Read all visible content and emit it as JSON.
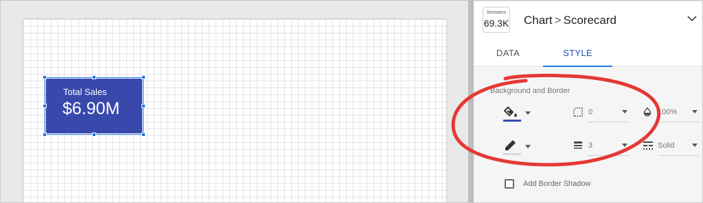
{
  "scorecard": {
    "label": "Total Sales",
    "value": "$6.90M"
  },
  "header": {
    "chip_label": "Sessions",
    "chip_value": "69.3K",
    "crumb_parent": "Chart",
    "crumb_separator": ">",
    "crumb_current": "Scorecard"
  },
  "tabs": [
    {
      "label": "DATA"
    },
    {
      "label": "STYLE"
    }
  ],
  "active_tab": "STYLE",
  "background_border": {
    "title": "Background and Border",
    "corner_radius": "0",
    "opacity": "100%",
    "border_weight": "3",
    "border_style": "Solid"
  },
  "shadow": {
    "label": "Add Border Shadow",
    "checked": false
  },
  "colors": {
    "scorecard_bg": "#3949ab",
    "fill_swatch": "#3949ab",
    "accent": "#1a73e8",
    "annotation": "#e53935"
  }
}
